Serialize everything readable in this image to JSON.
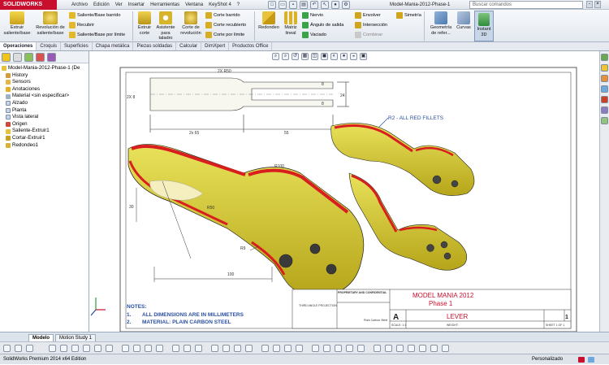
{
  "app": {
    "logo": "SOLIDWORKS",
    "doc_title": "Model-Mania-2012-Phase-1"
  },
  "menu": [
    "Archivo",
    "Edición",
    "Ver",
    "Insertar",
    "Herramientas",
    "Ventana",
    "KeyShot 4",
    "?"
  ],
  "search": {
    "placeholder": "Buscar comandos"
  },
  "ribbon": {
    "extruir_saliente": "Extruir saliente/base",
    "revolucion_saliente": "Revolución de saliente/base",
    "saliente_barrido": "Saliente/Base barrido",
    "recubrir": "Recubrir",
    "saliente_limite": "Saliente/Base por límite",
    "extruir_corte": "Extruir corte",
    "asistente_taladro": "Asistente para taladro",
    "corte_revolucion": "Corte de revolución",
    "corte_barrido": "Corte barrido",
    "corte_recubierto": "Corte recubierto",
    "corte_limite": "Corte por límite",
    "redondeo": "Redondeo",
    "matriz_lineal": "Matriz lineal",
    "nervio": "Nervio",
    "angulo_salida": "Ángulo de salida",
    "vaciado": "Vaciado",
    "envolver": "Envolver",
    "interseccion": "Intersección",
    "combinar": "Combinar",
    "simetria": "Simetría",
    "geometria_ref": "Geometría de refer...",
    "curvas": "Curvas",
    "instant3d": "Instant 3D"
  },
  "cm_tabs": [
    "Operaciones",
    "Croquis",
    "Superficies",
    "Chapa metálica",
    "Piezas soldadas",
    "Calcular",
    "DimXpert",
    "Productos Office"
  ],
  "tree": {
    "root": "Model-Mania-2012-Phase-1 (De",
    "items": [
      "History",
      "Sensors",
      "Anotaciones",
      "Material <sin especificar>",
      "Alzado",
      "Planta",
      "Vista lateral",
      "Origen",
      "Saliente-Extruir1",
      "Cortar-Extruir1",
      "Redondeo1"
    ]
  },
  "drawing": {
    "dim_2x_r50": "2X R50",
    "dim_2x_8": "2X 8",
    "dim_8": "8",
    "dim_24": "24",
    "dim_8b": "8",
    "dim_2x_65": "2x 65",
    "dim_55": "55",
    "fillet_note": "R2 - ALL RED FILLETS",
    "dim_r100": "R100",
    "dim_30": "30",
    "dim_r50": "R50",
    "dim_r9": "R9",
    "dim_100": "100",
    "notes_title": "NOTES:",
    "note1_num": "1.",
    "note1": "ALL DIMENSIONS ARE IN MILLIMETERS",
    "note2_num": "2.",
    "note2": "MATERIAL: PLAIN CARBON STEEL",
    "tb_company": "MODEL MANIA 2012",
    "tb_phase": "Phase 1",
    "tb_title": "LEVER",
    "tb_size": "A",
    "tb_rev": "1",
    "tb_scale": "SCALE: 1:1",
    "tb_weight": "WEIGHT:",
    "tb_sheet": "SHEET 1 OF 1",
    "tb_proprietary": "PROPRIETARY AND CONFIDENTIAL",
    "tb_third": "THIRD ANGLE PROJECTION",
    "tb_material": "Plain Carbon Steel"
  },
  "bottom_tabs": [
    "Modelo",
    "Motion Study 1"
  ],
  "status": {
    "left": "SolidWorks Premium 2014 x64 Edition",
    "right": "Personalizado"
  }
}
